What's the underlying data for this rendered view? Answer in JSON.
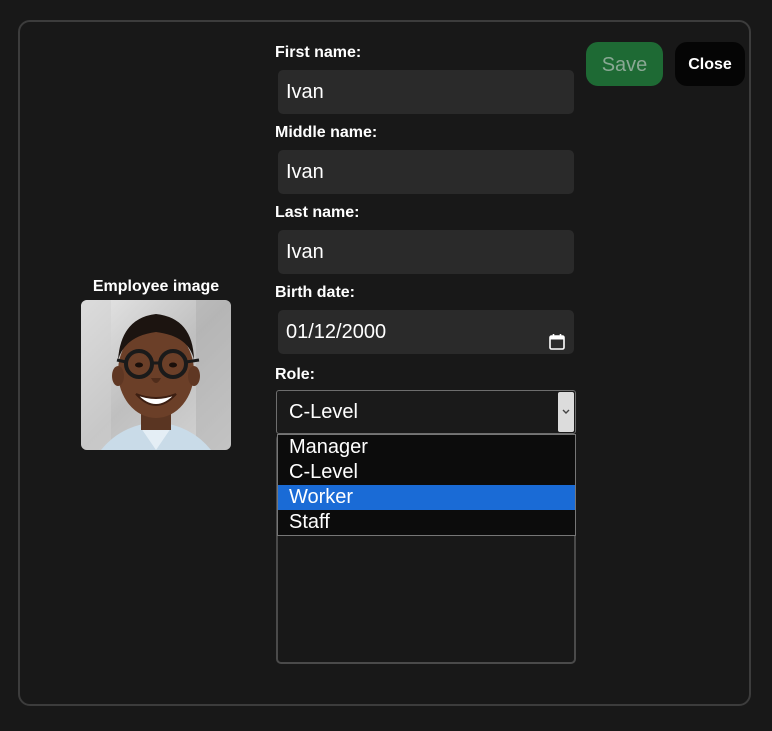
{
  "form": {
    "image_label": "Employee image",
    "fields": [
      {
        "label": "First name:",
        "value": "Ivan"
      },
      {
        "label": "Middle name:",
        "value": "Ivan"
      },
      {
        "label": "Last name:",
        "value": "Ivan"
      },
      {
        "label": "Birth date:",
        "value": "01/12/2000"
      }
    ],
    "role": {
      "label": "Role:",
      "value": "C-Level",
      "options": [
        "Manager",
        "C-Level",
        "Worker",
        "Staff"
      ],
      "highlighted": "Worker"
    }
  },
  "actions": {
    "save_label": "Save",
    "close_label": "Close"
  },
  "colors": {
    "background": "#181818",
    "input_bg": "#2a2a2a",
    "save_bg": "#1e6a34",
    "highlight": "#1a6bd6"
  }
}
